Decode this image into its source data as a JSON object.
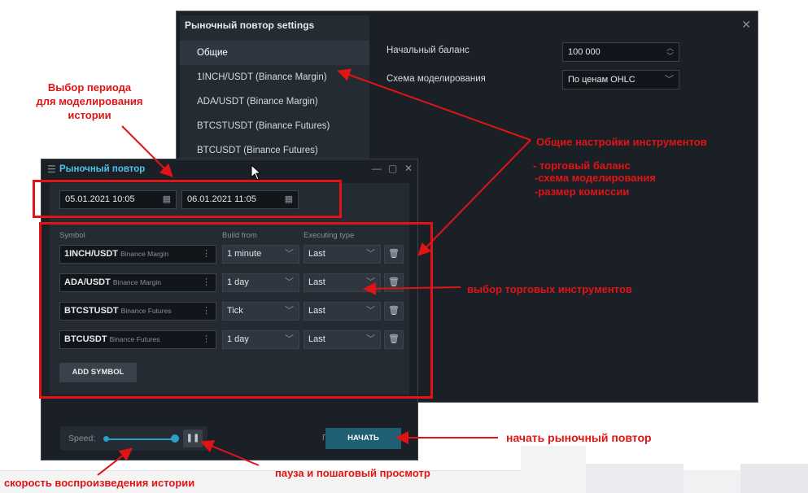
{
  "settings": {
    "title": "Рыночный повтор settings",
    "close": "✕",
    "sidebar": [
      {
        "label": "Общие",
        "active": true
      },
      {
        "label": "1INCH/USDT (Binance Margin)"
      },
      {
        "label": "ADA/USDT (Binance Margin)"
      },
      {
        "label": "BTCSTUSDT (Binance Futures)"
      },
      {
        "label": "BTCUSDT (Binance Futures)"
      }
    ],
    "balance_label": "Начальный баланс",
    "balance_value": "100 000",
    "scheme_label": "Схема моделирования",
    "scheme_value": "По ценам OHLC"
  },
  "replay": {
    "title": "Рыночный повтор",
    "date_from": "05.01.2021 10:05",
    "date_to": "06.01.2021 11:05",
    "columns": {
      "symbol": "Symbol",
      "build": "Build from",
      "exec": "Executing type"
    },
    "rows": [
      {
        "symbol": "1INCH/USDT",
        "exchange": "Binance Margin",
        "build": "1 minute",
        "exec": "Last"
      },
      {
        "symbol": "ADA/USDT",
        "exchange": "Binance Margin",
        "build": "1 day",
        "exec": "Last"
      },
      {
        "symbol": "BTCSTUSDT",
        "exchange": "Binance Futures",
        "build": "Tick",
        "exec": "Last"
      },
      {
        "symbol": "BTCUSDT",
        "exchange": "Binance Futures",
        "build": "1 day",
        "exec": "Last"
      }
    ],
    "add_symbol": "ADD SYMBOL",
    "speed_label": "Speed:",
    "speed_level": 1.0,
    "start_button": "НАЧАТЬ",
    "start_peek": "Г"
  },
  "annotations": {
    "period_1": "Выбор периода",
    "period_2": "для моделирования",
    "period_3": "истории",
    "general": "Общие настройки инструментов",
    "bullet_1": "- торговый баланс",
    "bullet_2": "-схема моделирования",
    "bullet_3": "-размер комиссии",
    "instruments": "выбор торговых  инструментов",
    "start": "начать рыночный повтор",
    "pause": "пауза и пошаговый просмотр",
    "speed": "скорость воспроизведения истории"
  },
  "colors": {
    "annotation": "#e01414",
    "accent": "#4fc3e8",
    "slider": "#2b9fc7",
    "start": "#1e5f73"
  }
}
